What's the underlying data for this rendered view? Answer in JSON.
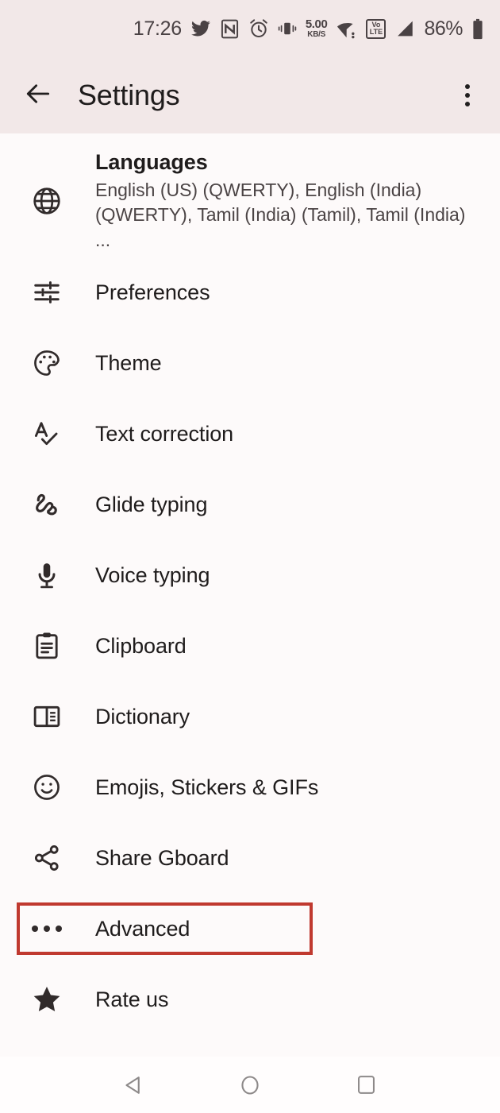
{
  "status_bar": {
    "clock": "17:26",
    "network_speed_value": "5.00",
    "network_speed_unit": "KB/S",
    "volte_top": "Vo",
    "volte_bottom": "LTE",
    "battery_percent": "86%",
    "icons": [
      "twitter-icon",
      "nfc-icon",
      "alarm-icon",
      "vibrate-icon",
      "network-speed-icon",
      "wifi-icon",
      "volte-icon",
      "cellular-signal-icon",
      "battery-icon"
    ]
  },
  "app_bar": {
    "back_label": "back-arrow",
    "title": "Settings",
    "overflow_label": "more-options"
  },
  "list": {
    "items": [
      {
        "icon": "globe-icon",
        "title": "Languages",
        "subtitle": "English (US) (QWERTY), English (India) (QWERTY), Tamil (India) (Tamil), Tamil (India) ..."
      },
      {
        "icon": "tune-icon",
        "title": "Preferences",
        "subtitle": ""
      },
      {
        "icon": "palette-icon",
        "title": "Theme",
        "subtitle": ""
      },
      {
        "icon": "spellcheck-icon",
        "title": "Text correction",
        "subtitle": ""
      },
      {
        "icon": "gesture-icon",
        "title": "Glide typing",
        "subtitle": ""
      },
      {
        "icon": "microphone-icon",
        "title": "Voice typing",
        "subtitle": ""
      },
      {
        "icon": "clipboard-icon",
        "title": "Clipboard",
        "subtitle": ""
      },
      {
        "icon": "book-icon",
        "title": "Dictionary",
        "subtitle": ""
      },
      {
        "icon": "emoji-icon",
        "title": "Emojis, Stickers & GIFs",
        "subtitle": ""
      },
      {
        "icon": "share-icon",
        "title": "Share Gboard",
        "subtitle": ""
      },
      {
        "icon": "more-horizontal-icon",
        "title": "Advanced",
        "subtitle": ""
      },
      {
        "icon": "star-icon",
        "title": "Rate us",
        "subtitle": ""
      }
    ]
  },
  "highlight": {
    "target": "Advanced",
    "color": "#c0392f"
  },
  "nav_bar": {
    "back": "nav-back-icon",
    "home": "nav-home-icon",
    "recents": "nav-recents-icon"
  },
  "colors": {
    "app_bar_background": "#f2e8e8",
    "content_background": "#fdfafa",
    "nav_background": "#fffdfd",
    "primary_text": "#1f1c1c",
    "secondary_text": "#4b4445",
    "icon": "#312b2b",
    "highlight": "#c0392f"
  }
}
